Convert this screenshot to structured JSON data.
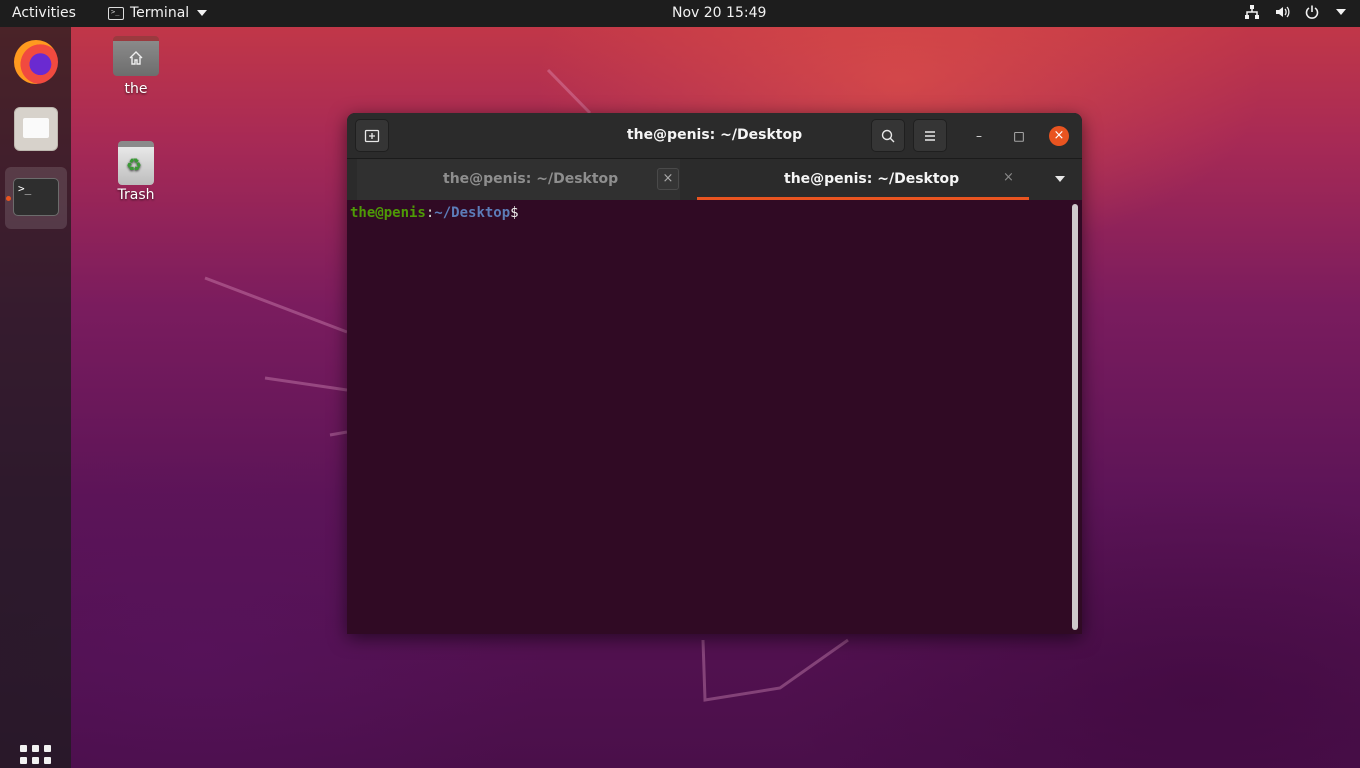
{
  "topbar": {
    "activities": "Activities",
    "app_name": "Terminal",
    "clock": "Nov 20  15:49",
    "tray_icons": [
      "network-icon",
      "volume-icon",
      "power-icon",
      "chevron-down-icon"
    ]
  },
  "dock": {
    "items": [
      {
        "name": "firefox",
        "icon": "firefox-icon"
      },
      {
        "name": "files",
        "icon": "files-icon"
      },
      {
        "name": "terminal",
        "icon": "terminal-icon",
        "running": true,
        "term_glyph": ">_"
      }
    ],
    "show_apps_icon": "app-grid-icon"
  },
  "desktop": {
    "icons": [
      {
        "label": "the",
        "icon": "home-folder-icon"
      },
      {
        "label": "Trash",
        "icon": "trash-icon",
        "glyph": "♻"
      }
    ]
  },
  "terminal_window": {
    "title": "the@penis: ~/Desktop",
    "tabs": [
      {
        "label": "the@penis: ~/Desktop",
        "active": false,
        "close": "×"
      },
      {
        "label": "the@penis: ~/Desktop",
        "active": true,
        "close": "×"
      }
    ],
    "controls": {
      "minimize": "–",
      "maximize": "□",
      "close": "×"
    },
    "prompt": {
      "user_host": "the@penis",
      "colon": ":",
      "path": "~/Desktop",
      "symbol": "$"
    },
    "colors": {
      "background": "#300a24",
      "accent": "#e95420",
      "user": "#4e9a06",
      "path": "#5c7cb8"
    }
  }
}
